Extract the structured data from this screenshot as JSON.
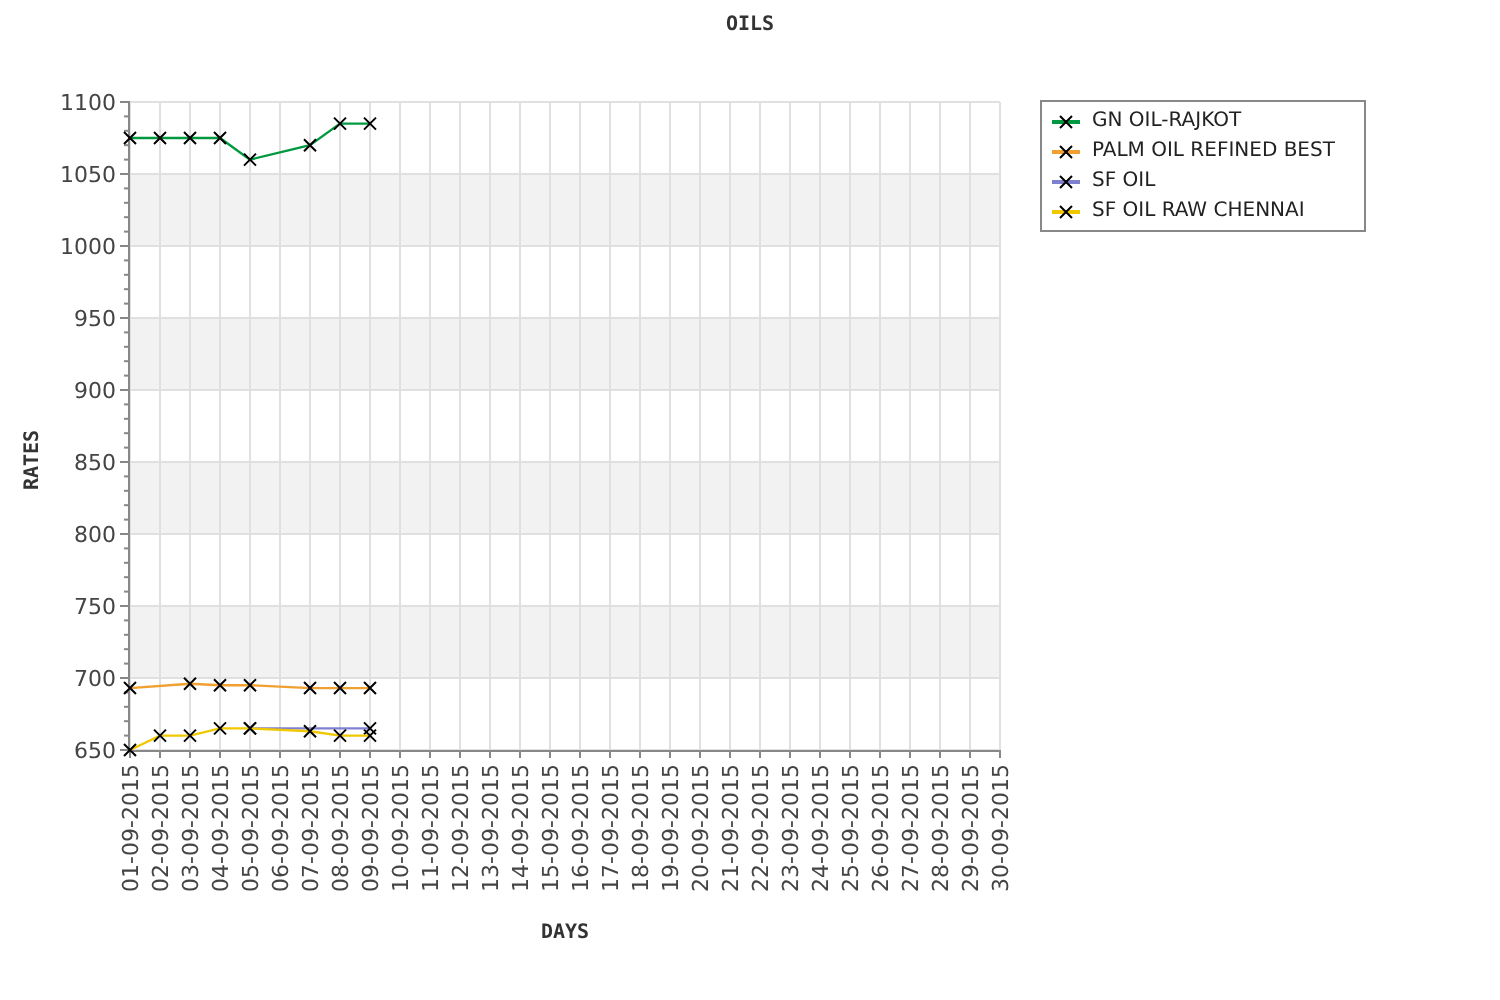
{
  "chart_data": {
    "type": "line",
    "title": "OILS",
    "xlabel": "DAYS",
    "ylabel": "RATES",
    "categories": [
      "01-09-2015",
      "02-09-2015",
      "03-09-2015",
      "04-09-2015",
      "05-09-2015",
      "06-09-2015",
      "07-09-2015",
      "08-09-2015",
      "09-09-2015",
      "10-09-2015",
      "11-09-2015",
      "12-09-2015",
      "13-09-2015",
      "14-09-2015",
      "15-09-2015",
      "16-09-2015",
      "17-09-2015",
      "18-09-2015",
      "19-09-2015",
      "20-09-2015",
      "21-09-2015",
      "22-09-2015",
      "23-09-2015",
      "24-09-2015",
      "25-09-2015",
      "26-09-2015",
      "27-09-2015",
      "28-09-2015",
      "29-09-2015",
      "30-09-2015"
    ],
    "series": [
      {
        "name": "GN OIL-RAJKOT",
        "color": "#009940",
        "marker": "x",
        "values": [
          1075,
          1075,
          1075,
          1075,
          1060,
          null,
          1070,
          1085,
          1085,
          null,
          null,
          null,
          null,
          null,
          null,
          null,
          null,
          null,
          null,
          null,
          null,
          null,
          null,
          null,
          null,
          null,
          null,
          null,
          null,
          null
        ]
      },
      {
        "name": "PALM OIL REFINED BEST",
        "color": "#f0a030",
        "marker": "x",
        "values": [
          693,
          null,
          696,
          695,
          695,
          null,
          693,
          693,
          693,
          null,
          null,
          null,
          null,
          null,
          null,
          null,
          null,
          null,
          null,
          null,
          null,
          null,
          null,
          null,
          null,
          null,
          null,
          null,
          null,
          null
        ]
      },
      {
        "name": "SF OIL",
        "color": "#8080d0",
        "marker": "x",
        "values": [
          null,
          null,
          null,
          null,
          665,
          null,
          null,
          null,
          665,
          null,
          null,
          null,
          null,
          null,
          null,
          null,
          null,
          null,
          null,
          null,
          null,
          null,
          null,
          null,
          null,
          null,
          null,
          null,
          null,
          null
        ]
      },
      {
        "name": "SF OIL RAW CHENNAI",
        "color": "#f0c800",
        "marker": "x",
        "values": [
          650,
          660,
          660,
          665,
          665,
          null,
          663,
          660,
          660,
          null,
          null,
          null,
          null,
          null,
          null,
          null,
          null,
          null,
          null,
          null,
          null,
          null,
          null,
          null,
          null,
          null,
          null,
          null,
          null,
          null
        ]
      }
    ],
    "grid": true,
    "ylim": [
      650,
      1100
    ],
    "yticks": [
      650,
      700,
      750,
      800,
      850,
      900,
      950,
      1000,
      1050,
      1100
    ]
  }
}
